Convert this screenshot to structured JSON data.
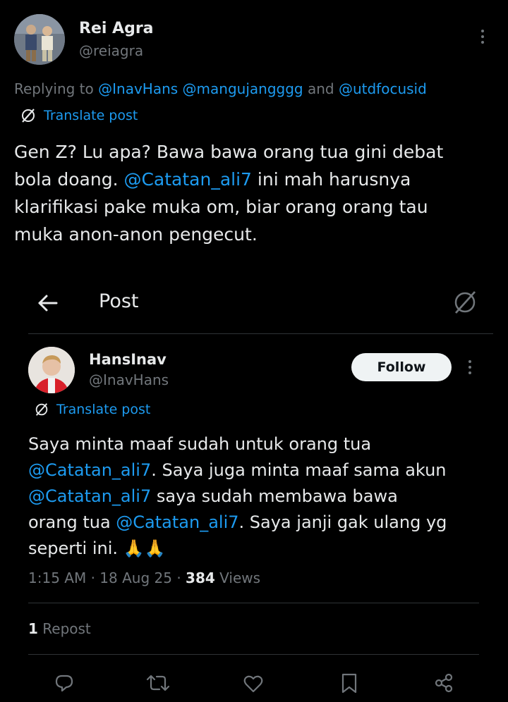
{
  "top_post": {
    "author_name": "Rei Agra",
    "author_handle": "@reiagra",
    "replying_prefix": "Replying to ",
    "replying_mentions": [
      "@InavHans",
      "@mangujangggg",
      "@utdfocusid"
    ],
    "replying_join": " and ",
    "translate_label": "Translate post",
    "text_parts": [
      {
        "t": "Gen Z? Lu apa? Bawa bawa orang tua gini debat\nbola doang. ",
        "link": false
      },
      {
        "t": "@Catatan_ali7",
        "link": true
      },
      {
        "t": " ini mah harusnya\nklarifikasi pake muka om, biar orang orang tau\nmuka anon-anon pengecut.",
        "link": false
      }
    ]
  },
  "header": {
    "title": "Post"
  },
  "quoted_post": {
    "author_name": "HansInav",
    "author_handle": "@InavHans",
    "follow_label": "Follow",
    "translate_label": "Translate post",
    "text_parts": [
      {
        "t": "Saya minta maaf sudah untuk orang tua\n",
        "link": false
      },
      {
        "t": "@Catatan_ali7",
        "link": true
      },
      {
        "t": ". Saya juga minta maaf sama akun\n",
        "link": false
      },
      {
        "t": "@Catatan_ali7",
        "link": true
      },
      {
        "t": " saya sudah membawa bawa\norang tua ",
        "link": false
      },
      {
        "t": "@Catatan_ali7",
        "link": true
      },
      {
        "t": ". Saya janji gak ulang yg\nseperti ini. 🙏🙏",
        "link": false
      }
    ],
    "time": "1:15 AM",
    "date": "18 Aug 25",
    "views_count": "384",
    "views_label": "Views",
    "repost_count": "1",
    "repost_label": "Repost"
  },
  "icons": {
    "back": "arrow-left-icon",
    "translate": "globe-slash-icon",
    "header_right": "globe-slash-icon",
    "more": "more-vertical-icon",
    "reply": "reply-icon",
    "retweet": "retweet-icon",
    "like": "heart-icon",
    "bookmark": "bookmark-icon",
    "share": "share-icon"
  },
  "colors": {
    "background": "#000000",
    "text": "#e7e9ea",
    "muted": "#71767b",
    "link": "#1d9bf0",
    "divider": "#2f3336",
    "follow_bg": "#eff3f4"
  }
}
